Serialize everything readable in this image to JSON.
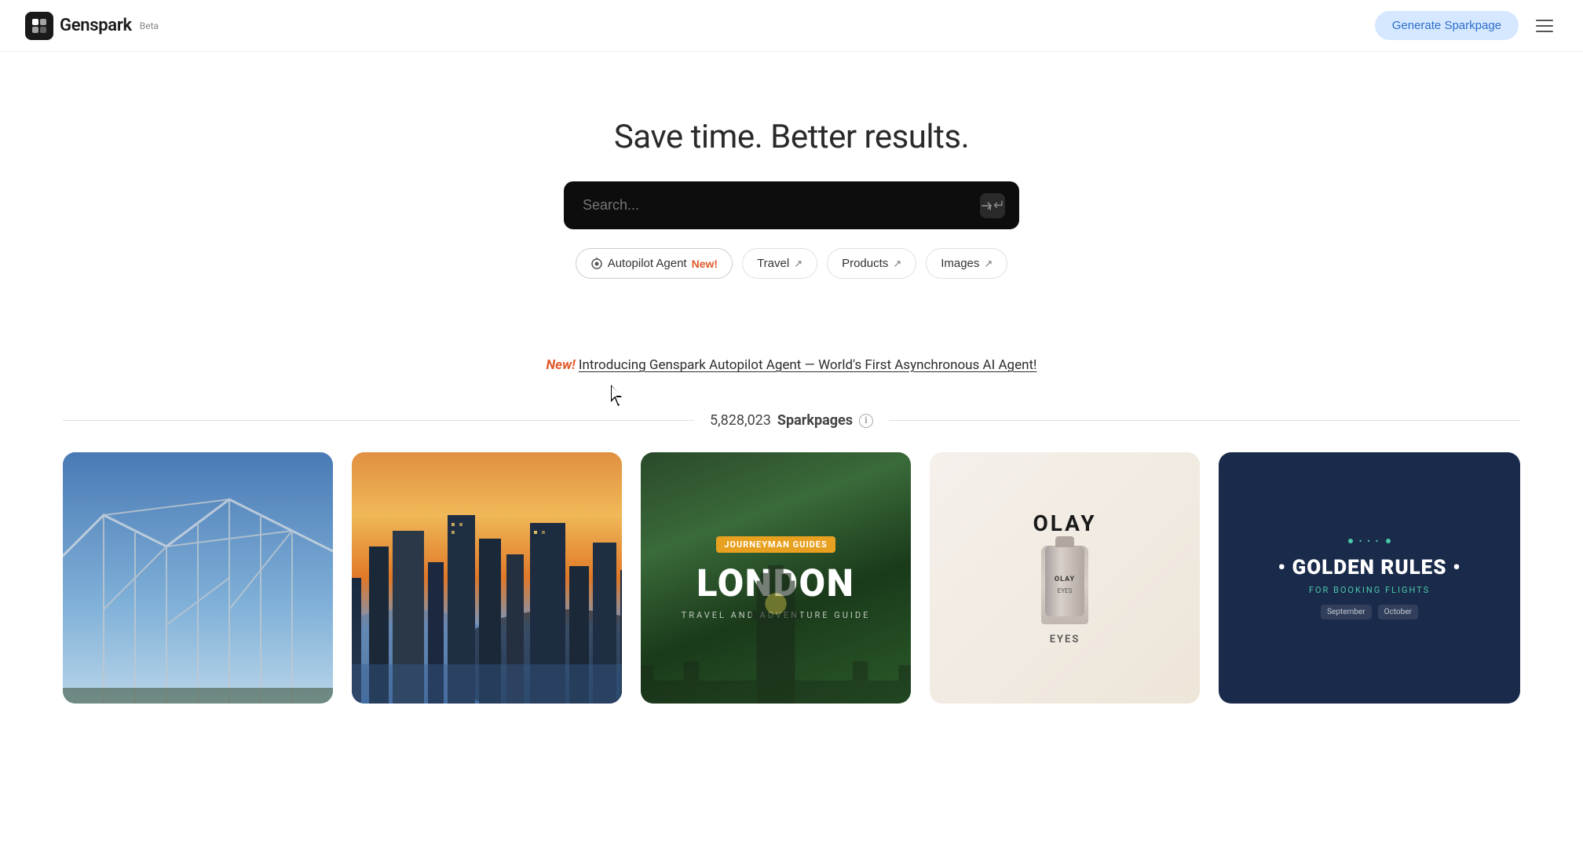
{
  "header": {
    "logo_text": "Genspark",
    "beta_label": "Beta",
    "generate_btn": "Generate Sparkpage",
    "menu_label": "Menu"
  },
  "hero": {
    "title": "Save time. Better results.",
    "search_placeholder": "Search..."
  },
  "quick_actions": [
    {
      "id": "autopilot",
      "icon": "autopilot-icon",
      "label": "Autopilot Agent",
      "badge": "New!",
      "arrow": null
    },
    {
      "id": "travel",
      "icon": "travel-icon",
      "label": "Travel",
      "badge": null,
      "arrow": "↗"
    },
    {
      "id": "products",
      "icon": "products-icon",
      "label": "Products",
      "badge": null,
      "arrow": "↗"
    },
    {
      "id": "images",
      "icon": "images-icon",
      "label": "Images",
      "badge": null,
      "arrow": "↗"
    }
  ],
  "announcement": {
    "new_label": "New!",
    "link_text": "Introducing Genspark Autopilot Agent — World's First Asynchronous AI Agent!"
  },
  "sparkpages": {
    "count": "5,828,023",
    "label": "Sparkpages",
    "info_icon": "ℹ"
  },
  "cards": [
    {
      "id": "card-1",
      "type": "roller-coaster",
      "alt": "Roller coaster against blue sky"
    },
    {
      "id": "card-2",
      "type": "city-skyline",
      "alt": "City skyline at sunset"
    },
    {
      "id": "card-3",
      "type": "london-guide",
      "badge": "Journeyman Guides",
      "title": "LONDON",
      "subtitle": "Travel and Adventure Guide"
    },
    {
      "id": "card-4",
      "type": "olay-product",
      "brand": "OLAY",
      "product": "EYES"
    },
    {
      "id": "card-5",
      "type": "golden-rules",
      "title": "GOLDEN RULES",
      "subtitle": "FOR BOOKING FLIGHTS",
      "months": [
        "September",
        "October"
      ]
    }
  ],
  "colors": {
    "accent_blue": "#2c6ecb",
    "accent_orange": "#e05a2b",
    "new_badge_color": "#e05a2b",
    "search_bg": "#0d0d0d",
    "generate_btn_bg": "#d6e8ff"
  }
}
